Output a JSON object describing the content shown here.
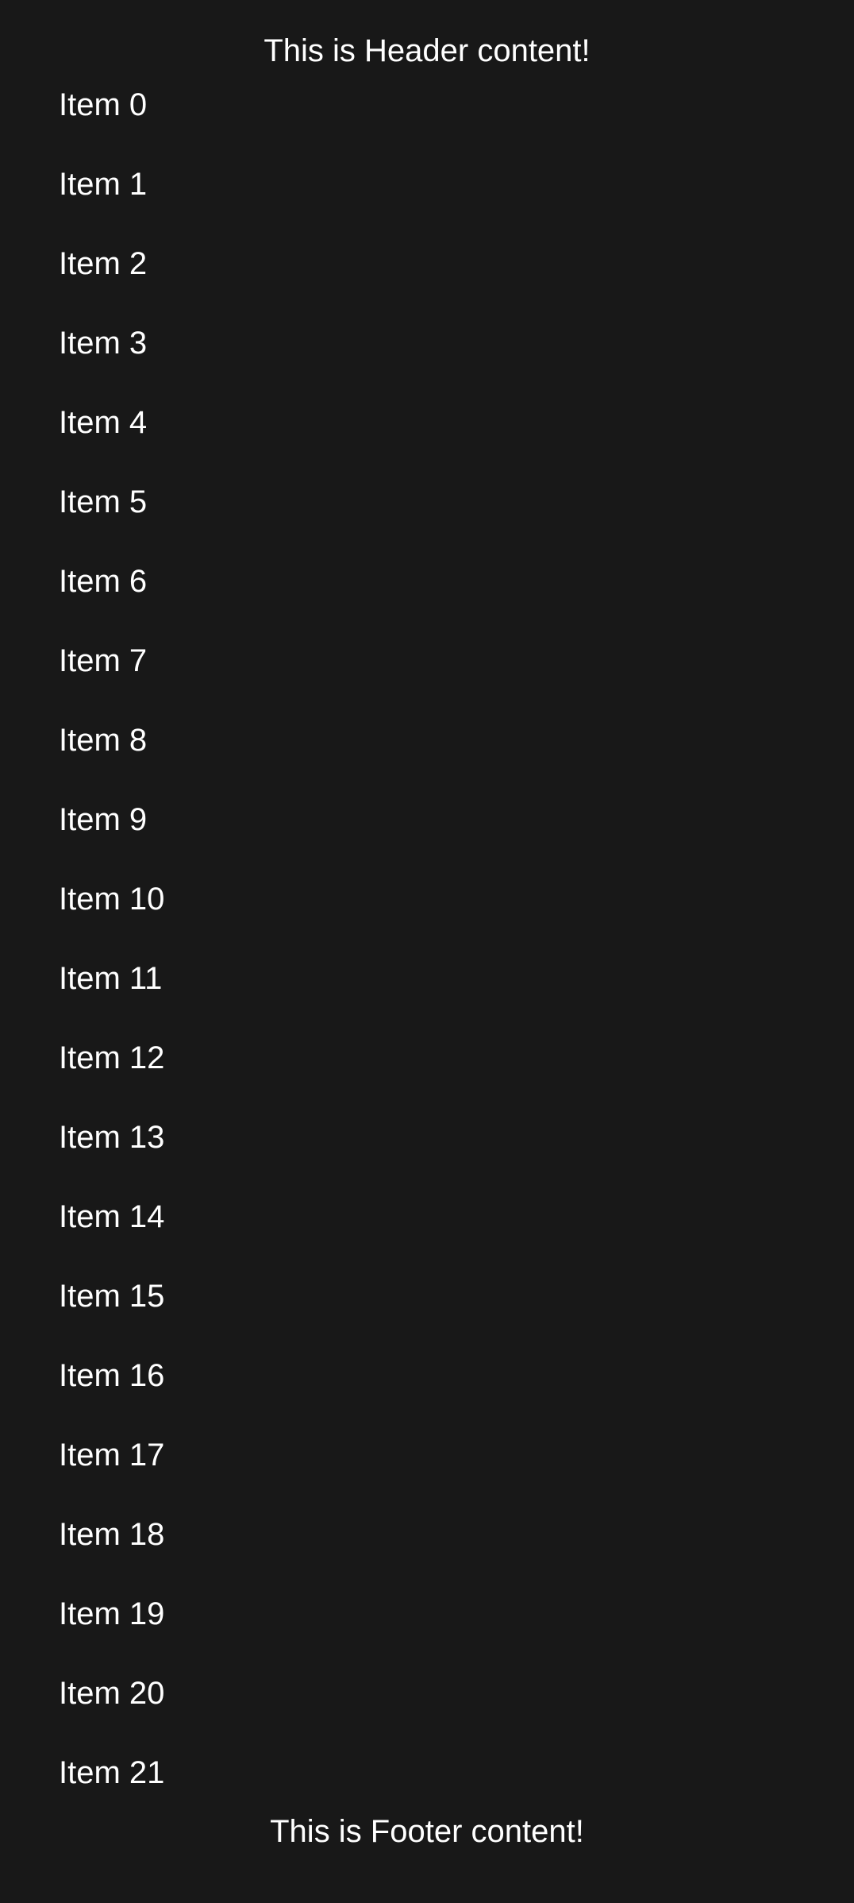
{
  "header": {
    "text": "This is Header content!"
  },
  "list": {
    "items": [
      "Item 0",
      "Item 1",
      "Item 2",
      "Item 3",
      "Item 4",
      "Item 5",
      "Item 6",
      "Item 7",
      "Item 8",
      "Item 9",
      "Item 10",
      "Item 11",
      "Item 12",
      "Item 13",
      "Item 14",
      "Item 15",
      "Item 16",
      "Item 17",
      "Item 18",
      "Item 19",
      "Item 20",
      "Item 21"
    ]
  },
  "footer": {
    "text": "This is Footer content!"
  },
  "colors": {
    "background": "#181818",
    "text": "#ffffff"
  }
}
